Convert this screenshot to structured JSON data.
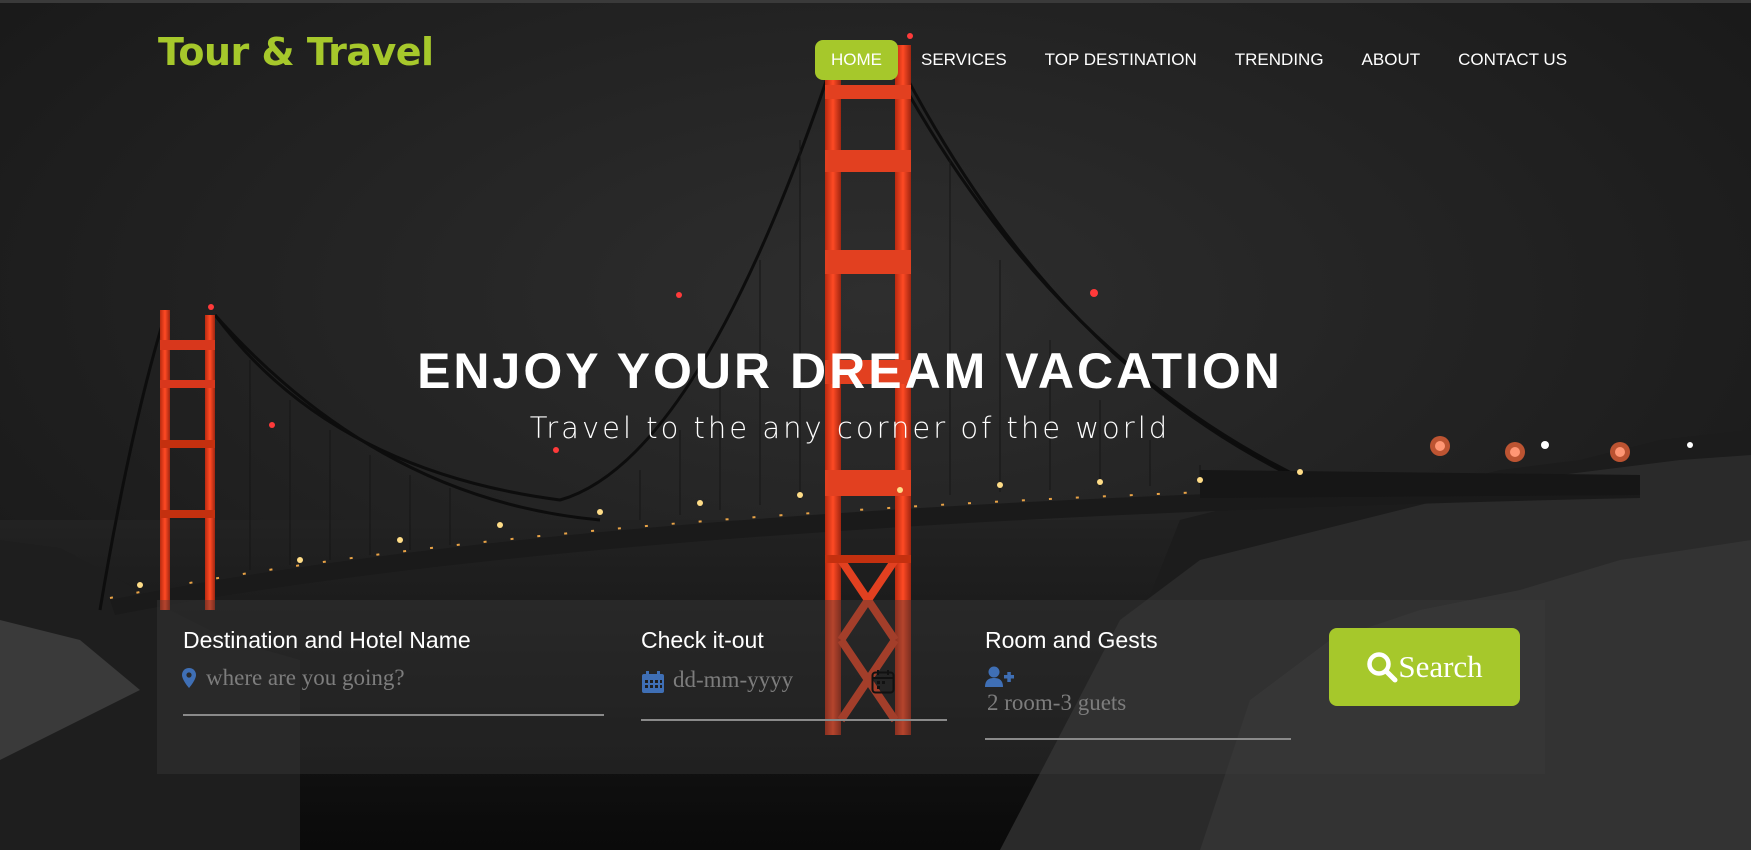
{
  "brand": {
    "name": "Tour & Travel",
    "color": "#a6c82b"
  },
  "nav": {
    "items": [
      {
        "label": "HOME",
        "active": true
      },
      {
        "label": "SERVICES"
      },
      {
        "label": "TOP DESTINATION"
      },
      {
        "label": "TRENDING"
      },
      {
        "label": "ABOUT"
      },
      {
        "label": "CONTACT US"
      }
    ]
  },
  "hero": {
    "title": "ENJOY YOUR DREAM VACATION",
    "subtitle": "Travel to the any corner of the world"
  },
  "search_form": {
    "destination": {
      "label": "Destination and Hotel Name",
      "placeholder": "where are you going?",
      "icon": "map-marker-icon"
    },
    "checkout": {
      "label": "Check it-out",
      "placeholder": "dd-mm-yyyy",
      "icon": "calendar-icon",
      "picker_icon": "calendar-picker-icon"
    },
    "guests": {
      "label": "Room and Gests",
      "placeholder": "2 room-3 guets",
      "icon": "user-plus-icon"
    },
    "button": {
      "label": "Search",
      "icon": "search-icon"
    }
  },
  "colors": {
    "accent": "#a6c82b",
    "icon_blue": "#3f6fb5",
    "bridge": "#d8371c"
  }
}
